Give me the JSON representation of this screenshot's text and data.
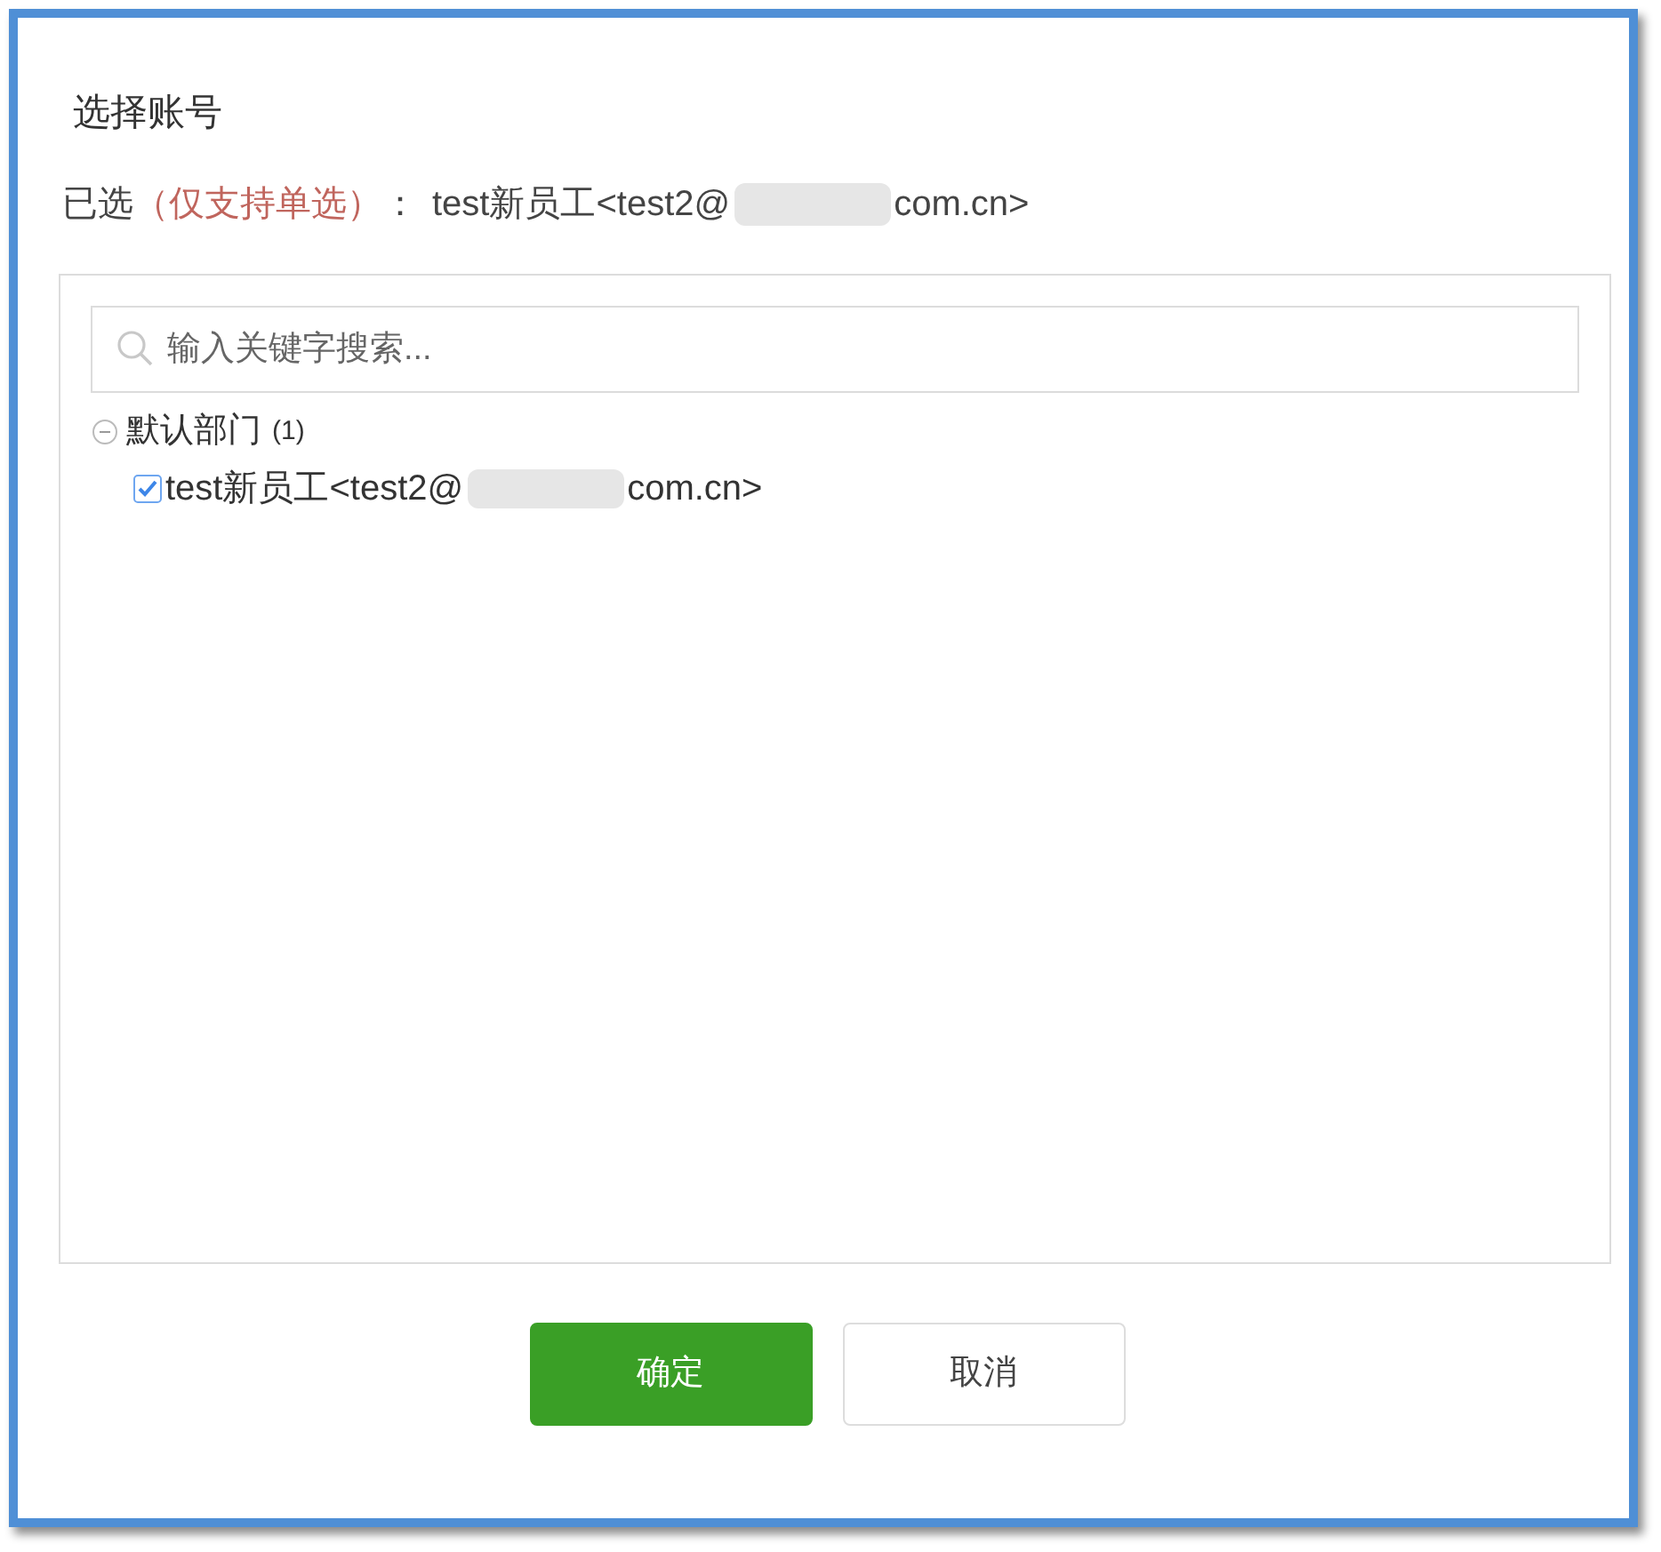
{
  "dialog": {
    "title": "选择账号"
  },
  "selection": {
    "label": "已选",
    "note": "（仅支持单选）",
    "separator": "：",
    "value_start": "test新员工<test2@",
    "value_end": "com.cn>",
    "redacted": true
  },
  "search": {
    "placeholder": "输入关键字搜索..."
  },
  "tree": [
    {
      "label": "默认部门",
      "count": "(1)",
      "expanded": true,
      "children": [
        {
          "label_start": "test新员工<test2@",
          "label_end": "com.cn>",
          "redacted": true,
          "checked": true
        }
      ]
    }
  ],
  "buttons": [
    {
      "label": "确定",
      "kind": "primary"
    },
    {
      "label": "取消",
      "kind": "secondary"
    }
  ]
}
